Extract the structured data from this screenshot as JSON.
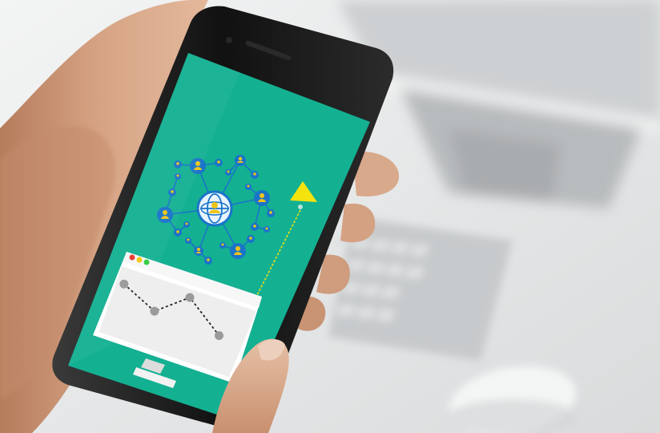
{
  "scene": {
    "subject": "hand-holding-smartphone",
    "screen_illustration": {
      "center_icon": "globe-icon",
      "node_icon": "user-icon",
      "pointer_icon": "triangle-arrow-icon",
      "window_dots": [
        "red",
        "yellow",
        "green"
      ]
    },
    "background": [
      "monitor",
      "keyboard",
      "mouse",
      "desk"
    ]
  },
  "colors": {
    "screen_teal": "#14b092",
    "network_blue": "#1a74c9",
    "user_yellow": "#f0c419",
    "arrow_yellow": "#f5e30f",
    "window_body": "#eeeeee",
    "window_bar": "#ffffff",
    "dot_red": "#e8392d",
    "dot_yellow": "#f1c40f",
    "dot_green": "#2ecc40",
    "phone_body": "#161616",
    "skin": "#d6a485"
  },
  "graph": {
    "points": [
      [
        0,
        0.7
      ],
      [
        1,
        0.1
      ],
      [
        2,
        1.0
      ],
      [
        3,
        0.0
      ]
    ]
  }
}
